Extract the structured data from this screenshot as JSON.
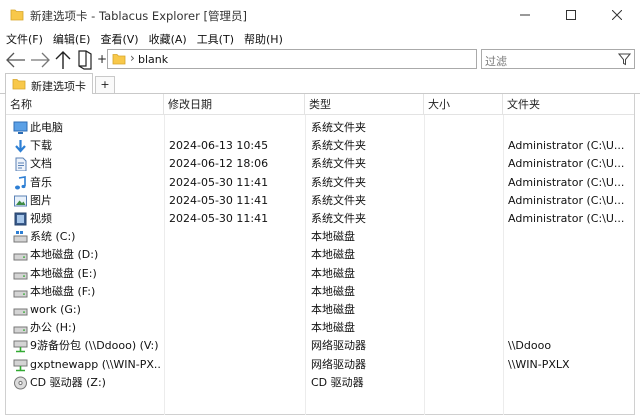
{
  "window": {
    "title": "新建选项卡 - Tablacus Explorer [管理员]"
  },
  "menu": [
    "文件(F)",
    "编辑(E)",
    "查看(V)",
    "收藏(A)",
    "工具(T)",
    "帮助(H)"
  ],
  "address": {
    "separator": "›",
    "path": "blank"
  },
  "filter": {
    "placeholder": "过滤"
  },
  "tabs": [
    {
      "label": "新建选项卡"
    }
  ],
  "tab_add_label": "+",
  "columns": [
    "名称",
    "修改日期",
    "类型",
    "大小",
    "文件夹"
  ],
  "rows": [
    {
      "icon": "computer-icon",
      "name": "此电脑",
      "date": "",
      "type": "系统文件夹",
      "size": "",
      "folder": ""
    },
    {
      "icon": "download-icon",
      "name": "下载",
      "date": "2024-06-13 10:45",
      "type": "系统文件夹",
      "size": "",
      "folder": "Administrator (C:\\U..."
    },
    {
      "icon": "document-icon",
      "name": "文档",
      "date": "2024-06-12 18:06",
      "type": "系统文件夹",
      "size": "",
      "folder": "Administrator (C:\\U..."
    },
    {
      "icon": "music-icon",
      "name": "音乐",
      "date": "2024-05-30 11:41",
      "type": "系统文件夹",
      "size": "",
      "folder": "Administrator (C:\\U..."
    },
    {
      "icon": "picture-icon",
      "name": "图片",
      "date": "2024-05-30 11:41",
      "type": "系统文件夹",
      "size": "",
      "folder": "Administrator (C:\\U..."
    },
    {
      "icon": "video-icon",
      "name": "视频",
      "date": "2024-05-30 11:41",
      "type": "系统文件夹",
      "size": "",
      "folder": "Administrator (C:\\U..."
    },
    {
      "icon": "system-drive-icon",
      "name": "系统 (C:)",
      "date": "",
      "type": "本地磁盘",
      "size": "",
      "folder": ""
    },
    {
      "icon": "drive-icon",
      "name": "本地磁盘 (D:)",
      "date": "",
      "type": "本地磁盘",
      "size": "",
      "folder": ""
    },
    {
      "icon": "drive-icon",
      "name": "本地磁盘 (E:)",
      "date": "",
      "type": "本地磁盘",
      "size": "",
      "folder": ""
    },
    {
      "icon": "drive-icon",
      "name": "本地磁盘 (F:)",
      "date": "",
      "type": "本地磁盘",
      "size": "",
      "folder": ""
    },
    {
      "icon": "drive-icon",
      "name": "work (G:)",
      "date": "",
      "type": "本地磁盘",
      "size": "",
      "folder": ""
    },
    {
      "icon": "drive-icon",
      "name": "办公 (H:)",
      "date": "",
      "type": "本地磁盘",
      "size": "",
      "folder": ""
    },
    {
      "icon": "network-drive-icon",
      "name": "9游备份包 (\\\\Ddooo) (V:)",
      "date": "",
      "type": "网络驱动器",
      "size": "",
      "folder": "\\\\Ddooo"
    },
    {
      "icon": "network-drive-icon",
      "name": "gxptnewapp (\\\\WIN-PX...",
      "date": "",
      "type": "网络驱动器",
      "size": "",
      "folder": "\\\\WIN-PXLX"
    },
    {
      "icon": "cd-drive-icon",
      "name": "CD 驱动器 (Z:)",
      "date": "",
      "type": "CD 驱动器",
      "size": "",
      "folder": ""
    }
  ],
  "colors": {
    "folder_yellow": "#f8c84a",
    "arrow_blue": "#2d7fd4",
    "border": "#c9c9c9"
  }
}
